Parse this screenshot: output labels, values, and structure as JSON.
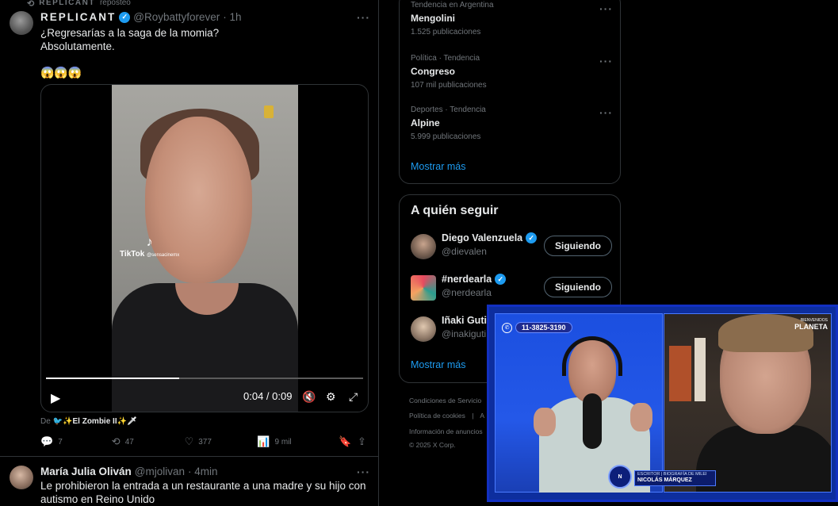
{
  "feed": {
    "repost": {
      "icon": "⟲",
      "user": "REPLICANT",
      "label": "reposteó"
    },
    "tweet1": {
      "name": "REPLICANT",
      "verified_mark": "✓",
      "handle": "@Roybattyforever",
      "time": "· 1h",
      "more": "···",
      "text_line1": "¿Regresarías a la saga de la momia?",
      "text_line2": "Absolutamente.",
      "emojis": "😱😱😱",
      "video": {
        "tiktok_label": "TikTok",
        "tiktok_handle": "@sensacinemx",
        "time_display": "0:04 / 0:09",
        "progress_fraction": 0.42,
        "play_icon": "▶",
        "mute_icon": "🔇",
        "settings_icon": "⚙",
        "fullscreen_icon": "⤢"
      },
      "from_prefix": "De",
      "from_source": "🐦✨El Zombie II✨🗡",
      "actions": {
        "replies": "7",
        "reposts": "47",
        "likes": "377",
        "views": "9 mil",
        "reply_icon": "💬",
        "repost_icon": "⟲",
        "like_icon": "♡",
        "views_icon": "📊",
        "bookmark_icon": "🔖",
        "share_icon": "⇪"
      }
    },
    "tweet2": {
      "name": "María Julia Oliván",
      "handle": "@mjolivan",
      "time": "· 4min",
      "more": "···",
      "text_line1": "Le prohibieron la entrada a un restaurante a una madre y su hijo con",
      "text_line2": "autismo en Reino Unido"
    }
  },
  "trends": {
    "items": [
      {
        "category": "Tendencia en Argentina",
        "topic": "Mengolini",
        "count": "1.525 publicaciones",
        "more": "···"
      },
      {
        "category": "Política · Tendencia",
        "topic": "Congreso",
        "count": "107 mil publicaciones",
        "more": "···"
      },
      {
        "category": "Deportes · Tendencia",
        "topic": "Alpine",
        "count": "5.999 publicaciones",
        "more": "···"
      }
    ],
    "show_more": "Mostrar más"
  },
  "who_to_follow": {
    "title": "A quién seguir",
    "users": [
      {
        "name": "Diego Valenzuela",
        "handle": "@dievalen",
        "verified_mark": "✓",
        "button": "Siguiendo"
      },
      {
        "name": "#nerdearla",
        "handle": "@nerdearla",
        "verified_mark": "✓",
        "button": "Siguiendo"
      },
      {
        "name": "Iñaki Gutie",
        "handle": "@inakiguti"
      }
    ],
    "show_more": "Mostrar más"
  },
  "footer": {
    "line1": "Condiciones de Servicio",
    "line2a": "Política de cookies",
    "line2b": "|",
    "line2c": "A",
    "line3": "Información de anuncios",
    "line4": "© 2025 X Corp."
  },
  "stream_overlay": {
    "phone": "11-3825-3190",
    "whatsapp_icon": "✆",
    "brand": "PLANETA",
    "brand_sub": "BIENVENIDOS",
    "logo_text": "N",
    "lower_third_role": "ESCRITOR | BIOGRAFÍA DE MILEI",
    "lower_third_name": "NICOLÁS MÁRQUEZ",
    "colors": {
      "frame": "#1230c2",
      "panel": "#2458e8"
    }
  },
  "colors": {
    "background": "#000000",
    "accent": "#1d9bf0",
    "muted": "#71767b",
    "border": "#2f3336"
  }
}
